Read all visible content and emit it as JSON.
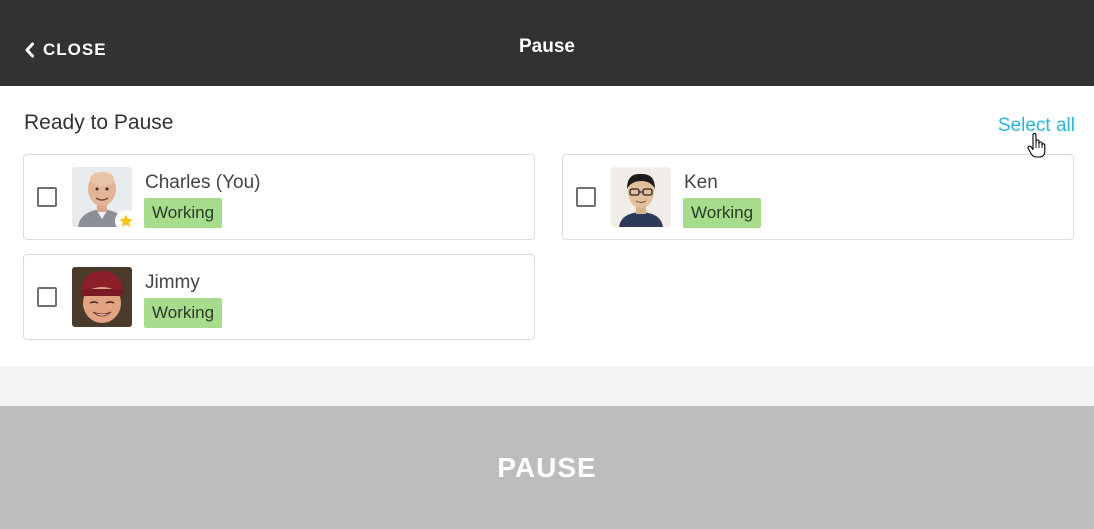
{
  "header": {
    "close_label": "CLOSE",
    "title": "Pause"
  },
  "section": {
    "title": "Ready to Pause",
    "select_all_label": "Select all"
  },
  "members": [
    {
      "name": "Charles (You)",
      "status": "Working",
      "checked": false,
      "favorite": true,
      "avatar": "bald-man-avatar"
    },
    {
      "name": "Ken",
      "status": "Working",
      "checked": false,
      "favorite": false,
      "avatar": "man-glasses-avatar"
    },
    {
      "name": "Jimmy",
      "status": "Working",
      "checked": false,
      "favorite": false,
      "avatar": "man-red-beanie-avatar"
    }
  ],
  "footer": {
    "action_label": "PAUSE"
  },
  "colors": {
    "header_bg": "#323232",
    "accent": "#2bb7d9",
    "status_working": "#a6dc8c",
    "footer_disabled": "#bdbdbd",
    "star": "#f5c518"
  }
}
